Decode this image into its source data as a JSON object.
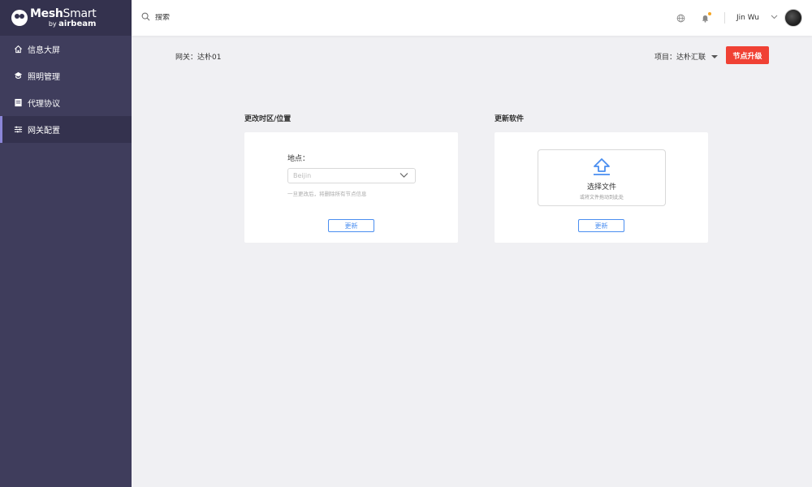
{
  "brand": {
    "name_bold": "Mesh",
    "name_light": "Smart",
    "by": "by ",
    "sub": "airbeam"
  },
  "sidebar": {
    "items": [
      {
        "label": "信息大屏",
        "icon": "home-icon",
        "active": false
      },
      {
        "label": "照明管理",
        "icon": "lighting-icon",
        "active": false
      },
      {
        "label": "代理协议",
        "icon": "document-icon",
        "active": false
      },
      {
        "label": "网关配置",
        "icon": "sliders-icon",
        "active": true
      }
    ]
  },
  "topbar": {
    "search_placeholder": "搜索",
    "user_name": "Jin Wu",
    "notification_dot_color": "#f5a623"
  },
  "page": {
    "breadcrumb": "网关：达朴01",
    "project_label": "项目：达朴汇联",
    "upgrade_label": "节点升级"
  },
  "timezone_section": {
    "title": "更改时区/位置",
    "location_label": "地点：",
    "location_value": "Beijin",
    "hint": "一旦更改后，将删除所有节点信息",
    "update_label": "更新"
  },
  "software_section": {
    "title": "更新软件",
    "drop_title": "选择文件",
    "drop_subtitle": "或将文件拖动到此处",
    "update_label": "更新"
  },
  "colors": {
    "sidebar_bg": "#3f3d5c",
    "accent": "#4a8ef0",
    "danger": "#f04134"
  }
}
